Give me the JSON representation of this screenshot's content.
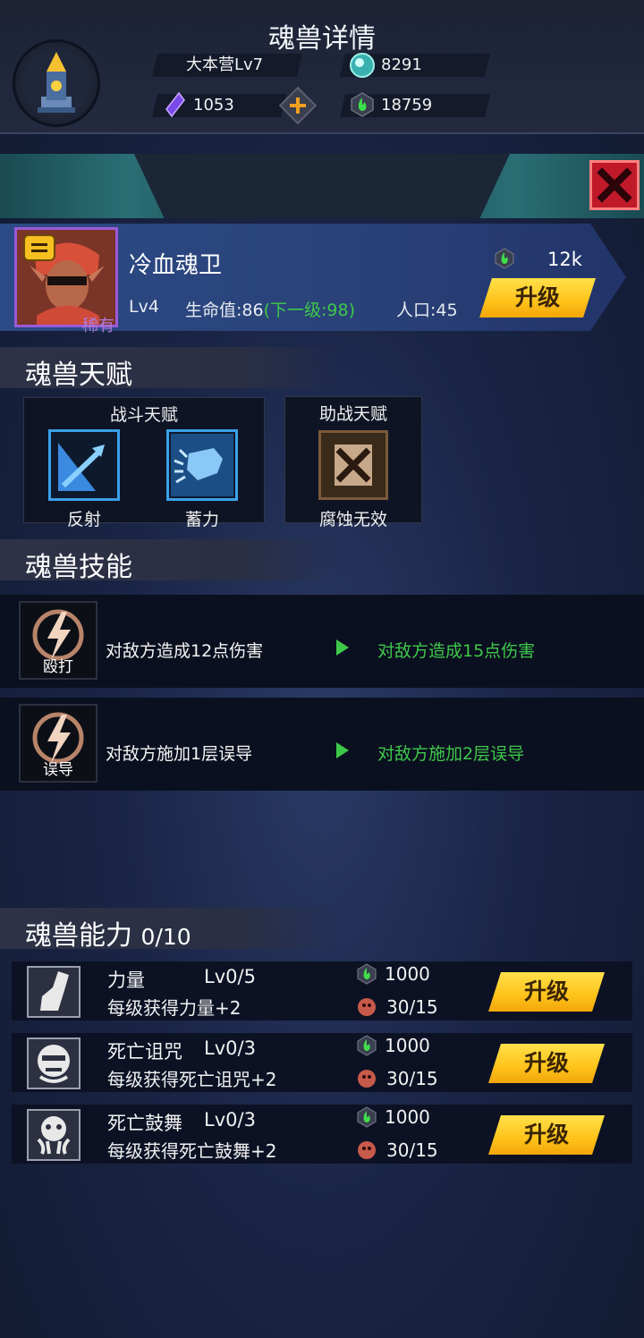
{
  "topbar": {
    "base_label": "大本营Lv7",
    "resource_1": "8291",
    "resource_gem": "1053",
    "resource_soul": "18759"
  },
  "title": "魂兽详情",
  "hero": {
    "name": "冷血魂卫",
    "rarity": "稀有",
    "level": "Lv4",
    "hp_label": "生命值:86",
    "hp_next": "(下一级:98)",
    "population": "人口:45",
    "upgrade_cost": "12k",
    "upgrade_label": "升级"
  },
  "talents": {
    "header": "魂兽天赋",
    "combat": {
      "title": "战斗天赋",
      "items": [
        {
          "label": "反射",
          "icon": "reflect-icon"
        },
        {
          "label": "蓄力",
          "icon": "charge-fist-icon"
        }
      ]
    },
    "assist": {
      "title": "助战天赋",
      "items": [
        {
          "label": "腐蚀无效",
          "icon": "corrosion-immune-icon"
        }
      ]
    }
  },
  "skills": {
    "header": "魂兽技能",
    "items": [
      {
        "icon_label": "殴打",
        "current": "对敌方造成12点伤害",
        "next": "对敌方造成15点伤害"
      },
      {
        "icon_label": "误导",
        "current": "对敌方施加1层误导",
        "next": "对敌方施加2层误导"
      }
    ]
  },
  "abilities": {
    "header": "魂兽能力",
    "count": "0/10",
    "items": [
      {
        "name": "力量",
        "level": "Lv0/5",
        "desc": "每级获得力量+2",
        "cost_soul": "1000",
        "cost_item": "30/15",
        "button": "升级",
        "icon": "arm-strength-icon"
      },
      {
        "name": "死亡诅咒",
        "level": "Lv0/3",
        "desc": "每级获得死亡诅咒+2",
        "cost_soul": "1000",
        "cost_item": "30/15",
        "button": "升级",
        "icon": "mask-curse-icon"
      },
      {
        "name": "死亡鼓舞",
        "level": "Lv0/3",
        "desc": "每级获得死亡鼓舞+2",
        "cost_soul": "1000",
        "cost_item": "30/15",
        "button": "升级",
        "icon": "skull-inspire-icon"
      }
    ]
  },
  "colors": {
    "accent_yellow": "#ffc21a",
    "green_text": "#3ec84a",
    "close_red": "#c01a2a",
    "rare_purple": "#9b5ad8"
  }
}
